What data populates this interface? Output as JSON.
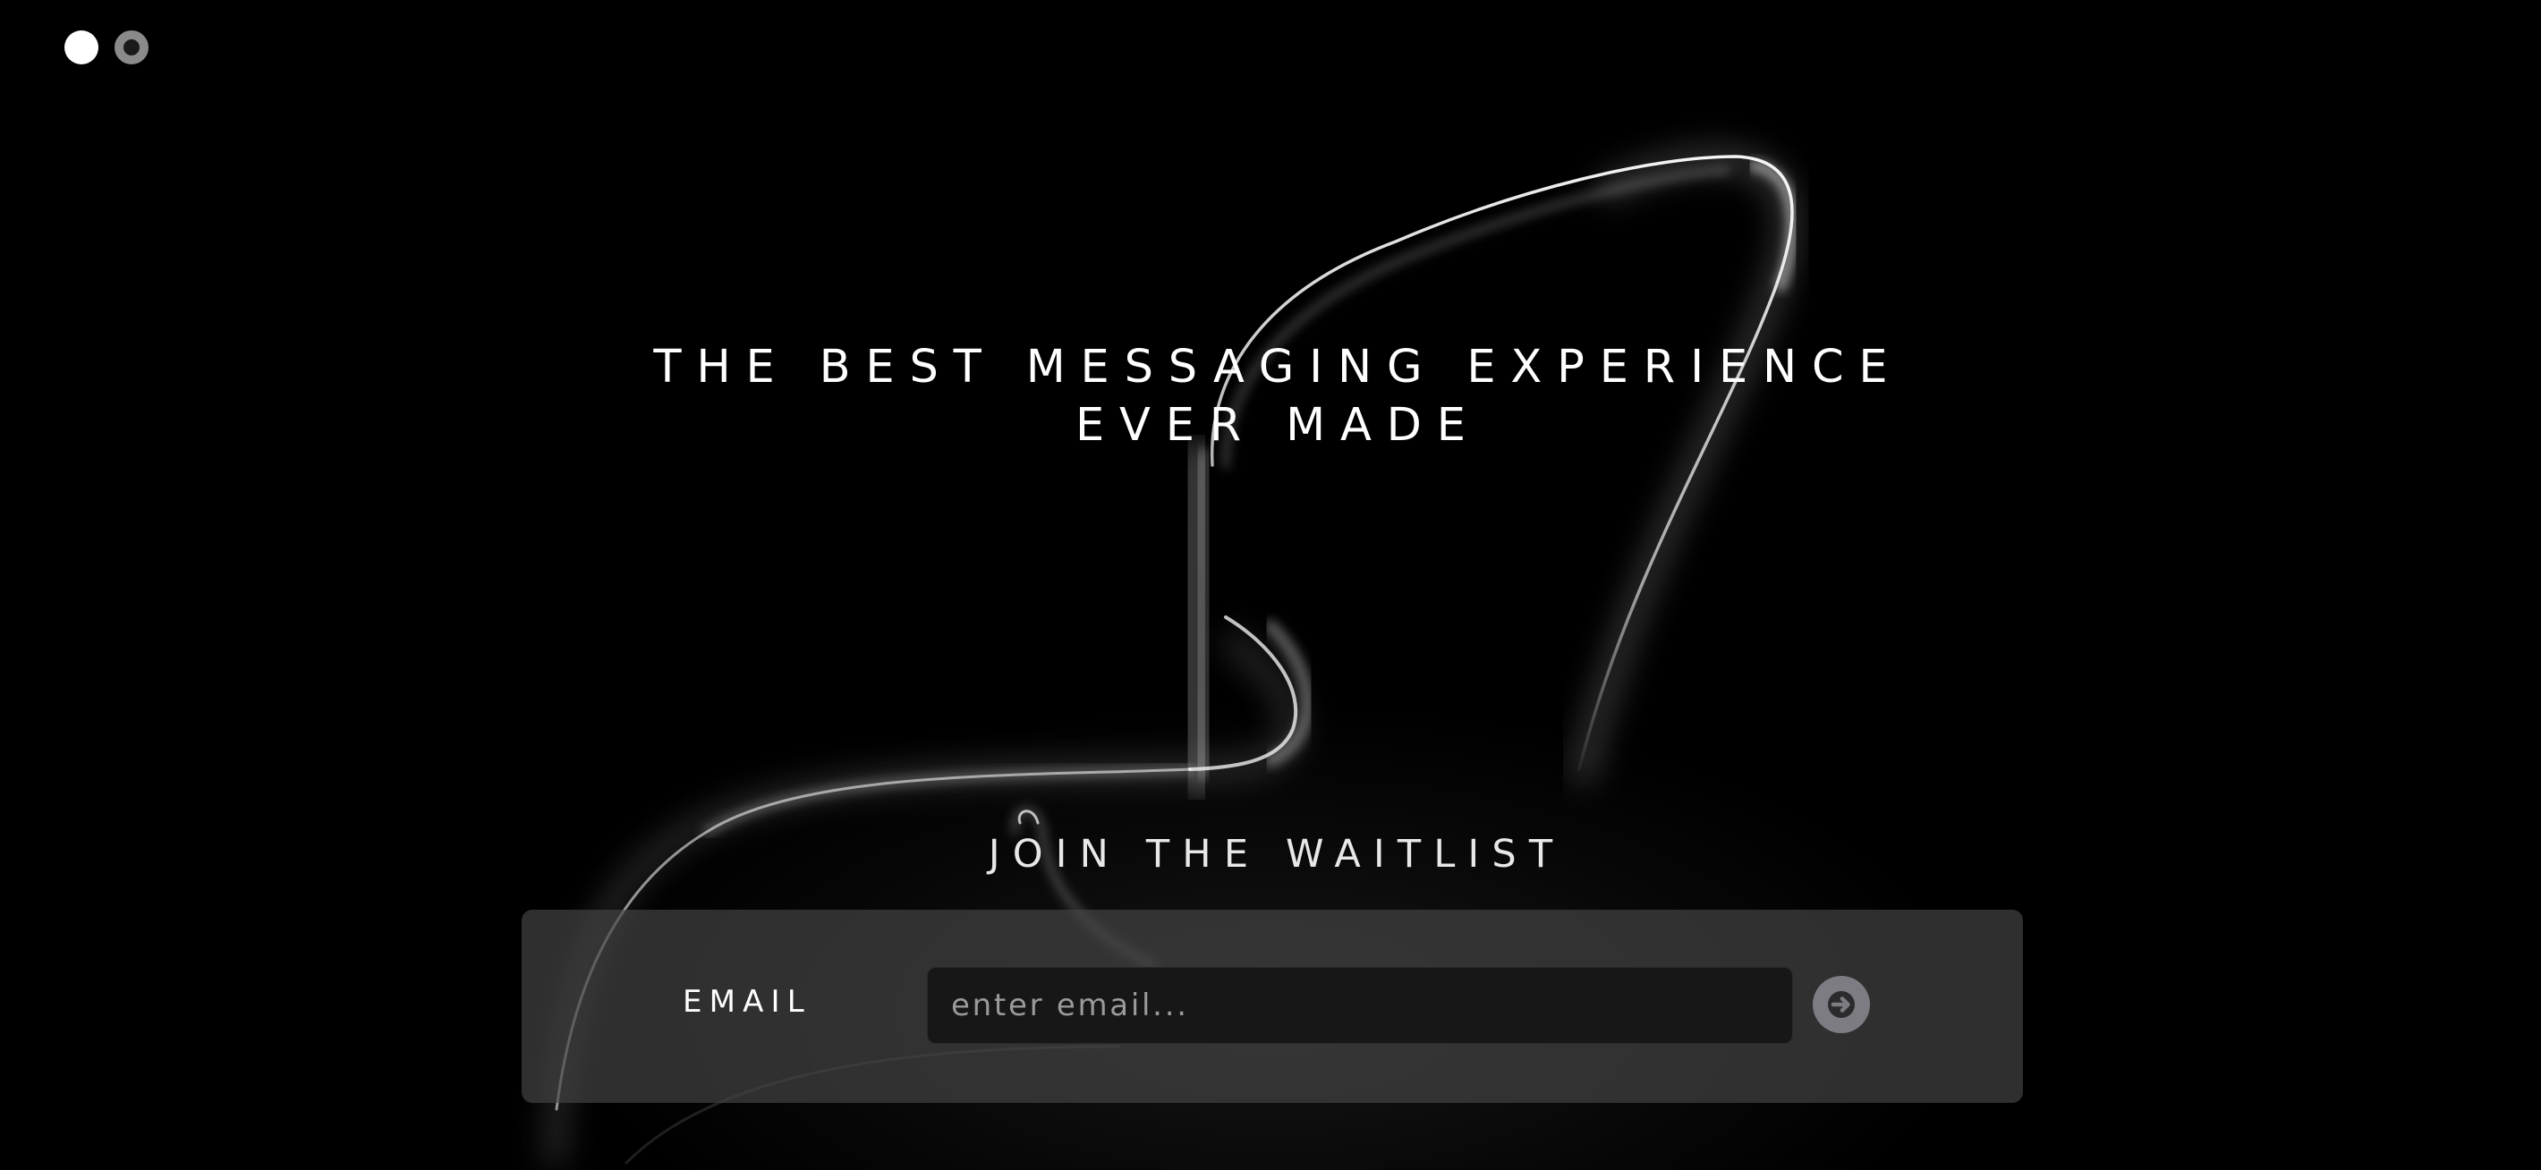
{
  "pager": {
    "dots": [
      "active",
      "inactive"
    ]
  },
  "hero": {
    "line1": "THE BEST MESSAGING EXPERIENCE",
    "line2": "EVER MADE"
  },
  "waitlist": {
    "title": "JOIN THE WAITLIST",
    "email_label": "EMAIL",
    "email_placeholder": "enter email...",
    "email_value": "",
    "submit_icon": "arrow-right-icon"
  },
  "colors": {
    "background": "#000000",
    "panel": "#464646",
    "input": "#171717",
    "submit": "#7c7c82"
  }
}
